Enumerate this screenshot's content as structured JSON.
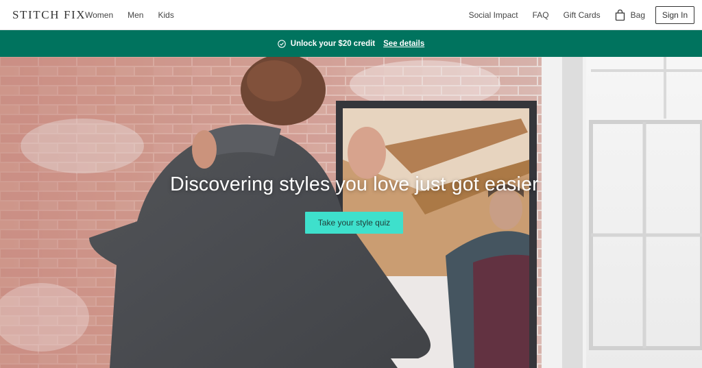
{
  "brand": {
    "logo_text": "STITCH FIX"
  },
  "nav": {
    "left": [
      {
        "label": "Women"
      },
      {
        "label": "Men"
      },
      {
        "label": "Kids"
      }
    ],
    "right": [
      {
        "label": "Social Impact"
      },
      {
        "label": "FAQ"
      },
      {
        "label": "Gift Cards"
      }
    ],
    "bag_label": "Bag",
    "bag_icon": "shopping-bag-icon",
    "signin_label": "Sign In"
  },
  "promo": {
    "icon": "check-circle-icon",
    "text": "Unlock your $20 credit",
    "link": "See details",
    "background": "#00735e"
  },
  "hero": {
    "headline": "Discovering styles you love just got easier",
    "cta_label": "Take your style quiz",
    "cta_color": "#3ee0cc"
  }
}
